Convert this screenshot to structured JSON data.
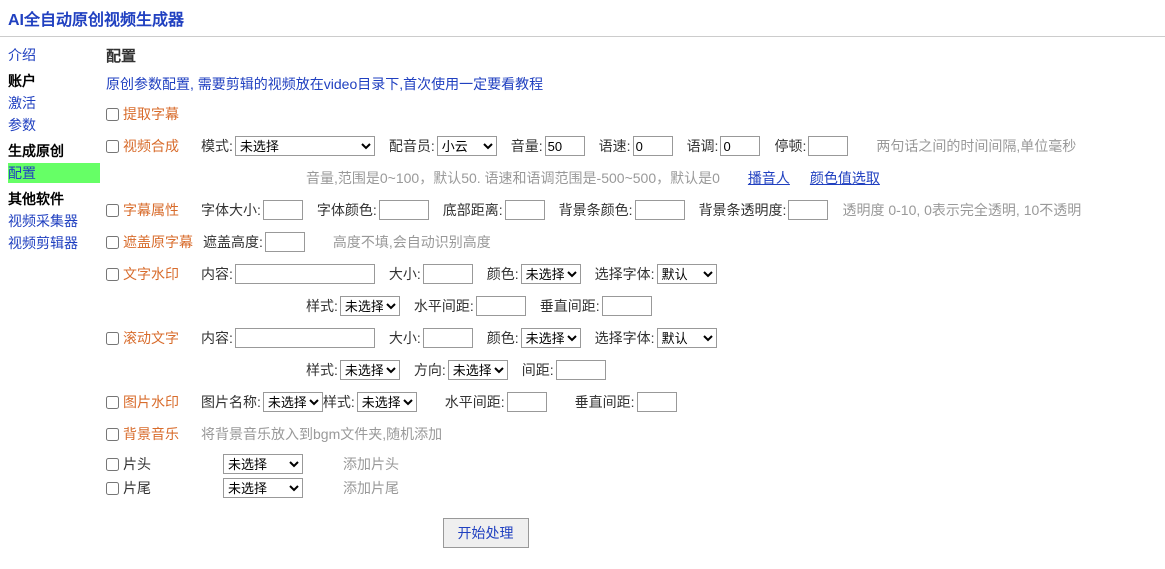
{
  "header": {
    "title": "AI全自动原创视频生成器"
  },
  "sidebar": {
    "intro": "介绍",
    "group_account": "账户",
    "activate": "激活",
    "params": "参数",
    "group_gen": "生成原创",
    "config": "配置",
    "group_other": "其他软件",
    "collector": "视频采集器",
    "editor": "视频剪辑器"
  },
  "content": {
    "title": "配置",
    "hint": "原创参数配置, 需要剪辑的视频放在video目录下,首次使用一定要看教程",
    "extract_sub": "提取字幕",
    "video_syn": {
      "title": "视频合成",
      "mode_label": "模式:",
      "mode_opt": "未选择",
      "voicer_label": "配音员:",
      "voicer_opt": "小云",
      "vol_label": "音量:",
      "vol_val": "50",
      "speed_label": "语速:",
      "speed_val": "0",
      "tone_label": "语调:",
      "tone_val": "0",
      "pause_label": "停顿:",
      "pause_note": "两句话之间的时间间隔,单位毫秒",
      "sub_hint": "音量,范围是0~100，默认50. 语速和语调范围是-500~500，默认是0",
      "link1": "播音人",
      "link2": "颜色值选取"
    },
    "sub_attr": {
      "title": "字幕属性",
      "font_size": "字体大小:",
      "font_color": "字体颜色:",
      "bottom_dist": "底部距离:",
      "bg_color": "背景条颜色:",
      "bg_alpha": "背景条透明度:",
      "alpha_note": "透明度 0-10, 0表示完全透明, 10不透明"
    },
    "cover_sub": {
      "title": "遮盖原字幕",
      "height_label": "遮盖高度:",
      "height_note": "高度不填,会自动识别高度"
    },
    "text_wm": {
      "title": "文字水印",
      "content_label": "内容:",
      "size_label": "大小:",
      "color_label": "颜色:",
      "color_opt": "未选择",
      "font_label": "选择字体:",
      "font_opt": "默认",
      "style_label": "样式:",
      "style_opt": "未选择",
      "h_spacing": "水平间距:",
      "v_spacing": "垂直间距:"
    },
    "scroll_text": {
      "title": "滚动文字",
      "content_label": "内容:",
      "size_label": "大小:",
      "color_label": "颜色:",
      "color_opt": "未选择",
      "font_label": "选择字体:",
      "font_opt": "默认",
      "style_label": "样式:",
      "style_opt": "未选择",
      "dir_label": "方向:",
      "dir_opt": "未选择",
      "spacing_label": "间距:"
    },
    "img_wm": {
      "title": "图片水印",
      "name_label": "图片名称:",
      "name_opt": "未选择",
      "style_label": "样式:",
      "style_opt": "未选择",
      "h_spacing": "水平间距:",
      "v_spacing": "垂直间距:"
    },
    "bgm": {
      "title": "背景音乐",
      "note": "将背景音乐放入到bgm文件夹,随机添加"
    },
    "head": {
      "title": "片头",
      "opt": "未选择",
      "note": "添加片头"
    },
    "tail": {
      "title": "片尾",
      "opt": "未选择",
      "note": "添加片尾"
    },
    "submit": "开始处理"
  }
}
